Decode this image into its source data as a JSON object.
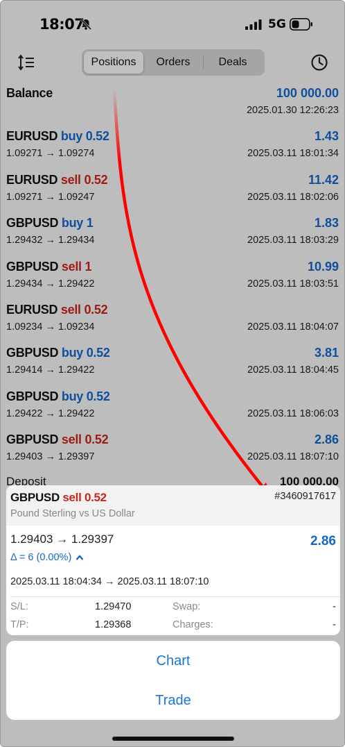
{
  "status": {
    "time": "18:07",
    "network": "5G"
  },
  "tabs": [
    "Positions",
    "Orders",
    "Deals"
  ],
  "balance": {
    "label": "Balance",
    "value": "100 000.00",
    "date": "2025.01.30 12:26:23"
  },
  "positions": [
    {
      "symbol": "EURUSD",
      "side": "buy 0.52",
      "type": "buy",
      "prices": "1.09271 → 1.09274",
      "profit": "1.43",
      "time": "2025.03.11 18:01:34"
    },
    {
      "symbol": "EURUSD",
      "side": "sell 0.52",
      "type": "sell",
      "prices": "1.09271 → 1.09247",
      "profit": "11.42",
      "time": "2025.03.11 18:02:06"
    },
    {
      "symbol": "GBPUSD",
      "side": "buy 1",
      "type": "buy",
      "prices": "1.29432 → 1.29434",
      "profit": "1.83",
      "time": "2025.03.11 18:03:29"
    },
    {
      "symbol": "GBPUSD",
      "side": "sell 1",
      "type": "sell",
      "prices": "1.29434 → 1.29422",
      "profit": "10.99",
      "time": "2025.03.11 18:03:51"
    },
    {
      "symbol": "EURUSD",
      "side": "sell 0.52",
      "type": "sell",
      "prices": "1.09234 → 1.09234",
      "profit": "",
      "time": "2025.03.11 18:04:07"
    },
    {
      "symbol": "GBPUSD",
      "side": "buy 0.52",
      "type": "buy",
      "prices": "1.29414 → 1.29422",
      "profit": "3.81",
      "time": "2025.03.11 18:04:45"
    },
    {
      "symbol": "GBPUSD",
      "side": "buy 0.52",
      "type": "buy",
      "prices": "1.29422 → 1.29422",
      "profit": "",
      "time": "2025.03.11 18:06:03"
    },
    {
      "symbol": "GBPUSD",
      "side": "sell 0.52",
      "type": "sell",
      "prices": "1.29403 → 1.29397",
      "profit": "2.86",
      "time": "2025.03.11 18:07:10"
    }
  ],
  "deposit": {
    "label": "Deposit",
    "value": "100 000.00"
  },
  "detail": {
    "symbol": "GBPUSD",
    "side": "sell 0.52",
    "ticket": "#3460917617",
    "description": "Pound Sterling vs US Dollar",
    "prices": "1.29403 → 1.29397",
    "profit": "2.86",
    "delta": "Δ = 6 (0.00%)",
    "times": "2025.03.11 18:04:34 → 2025.03.11 18:07:10",
    "sl_label": "S/L:",
    "sl_value": "1.29470",
    "tp_label": "T/P:",
    "tp_value": "1.29368",
    "swap_label": "Swap:",
    "swap_value": "-",
    "charges_label": "Charges:",
    "charges_value": "-"
  },
  "actions": {
    "chart": "Chart",
    "trade": "Trade"
  },
  "colors": {
    "buy": "#1466c8",
    "sell": "#c8261c",
    "annotation": "#ff0000",
    "link": "#1c74d6"
  }
}
